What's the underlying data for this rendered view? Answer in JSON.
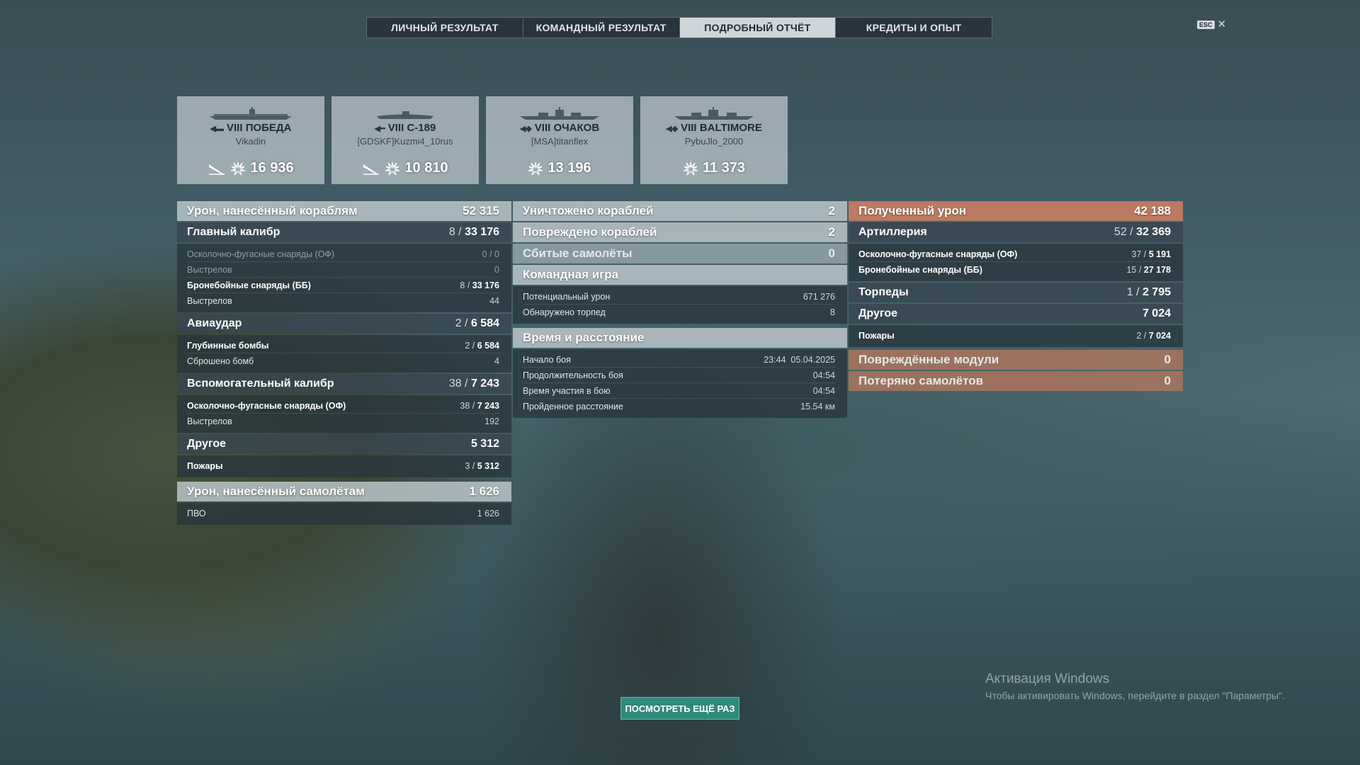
{
  "tabs": [
    "ЛИЧНЫЙ РЕЗУЛЬТАТ",
    "КОМАНДНЫЙ РЕЗУЛЬТАТ",
    "ПОДРОБНЫЙ ОТЧЁТ",
    "КРЕДИТЫ И ОПЫТ"
  ],
  "active_tab": "ПОДРОБНЫЙ ОТЧЁТ",
  "esc": {
    "key": "ESC",
    "close": "✕"
  },
  "ships": [
    {
      "tier": "VIII",
      "name": "ПОБЕДА",
      "player": "Vikadin",
      "damage": "16 936",
      "icon": "aircraft-carrier-icon"
    },
    {
      "tier": "VIII",
      "name": "С-189",
      "player": "[GDSKF]Kuzmi4_10rus",
      "damage": "10 810",
      "icon": "submarine-icon"
    },
    {
      "tier": "VIII",
      "name": "ОЧАКОВ",
      "player": "[MSA]titanflex",
      "damage": "13 196",
      "icon": "cruiser-icon"
    },
    {
      "tier": "VIII",
      "name": "BALTIMORE",
      "player": "PybuJlo_2000",
      "damage": "11 373",
      "icon": "cruiser-icon"
    }
  ],
  "col1": {
    "header": {
      "label": "Урон, нанесённый кораблям",
      "value": "52 315"
    },
    "main_battery": {
      "label": "Главный калибр",
      "hits": "8",
      "value": "33 176"
    },
    "he": {
      "label": "Осколочно-фугасные снаряды (ОФ)",
      "value": "0 / 0"
    },
    "he_shots": {
      "label": "Выстрелов",
      "value": "0"
    },
    "ap": {
      "label": "Бронебойные снаряды (ББ)",
      "hits": "8",
      "value": "33 176"
    },
    "ap_shots": {
      "label": "Выстрелов",
      "value": "44"
    },
    "airstrike": {
      "label": "Авиаудар",
      "hits": "2",
      "value": "6 584"
    },
    "depth": {
      "label": "Глубинные бомбы",
      "hits": "2",
      "value": "6 584"
    },
    "bombs": {
      "label": "Сброшено бомб",
      "value": "4"
    },
    "secondary": {
      "label": "Вспомогательный калибр",
      "hits": "38",
      "value": "7 243"
    },
    "sec_he": {
      "label": "Осколочно-фугасные снаряды (ОФ)",
      "hits": "38",
      "value": "7 243"
    },
    "sec_shots": {
      "label": "Выстрелов",
      "value": "192"
    },
    "other": {
      "label": "Другое",
      "value": "5 312"
    },
    "fires": {
      "label": "Пожары",
      "hits": "3",
      "value": "5 312"
    },
    "planes_header": {
      "label": "Урон, нанесённый самолётам",
      "value": "1 626"
    },
    "aa": {
      "label": "ПВО",
      "value": "1 626"
    }
  },
  "col2": {
    "destroyed": {
      "label": "Уничтожено кораблей",
      "value": "2"
    },
    "damaged": {
      "label": "Повреждено кораблей",
      "value": "2"
    },
    "planes": {
      "label": "Сбитые самолёты",
      "value": "0"
    },
    "team": {
      "label": "Командная игра"
    },
    "potential": {
      "label": "Потенциальный урон",
      "value": "671 276"
    },
    "torps_spotted": {
      "label": "Обнаружено торпед",
      "value": "8"
    },
    "time": {
      "label": "Время и расстояние"
    },
    "start": {
      "label": "Начало боя",
      "value": "23:44  05.04.2025"
    },
    "duration": {
      "label": "Продолжительность боя",
      "value": "04:54"
    },
    "participation": {
      "label": "Время участия в бою",
      "value": "04:54"
    },
    "distance": {
      "label": "Пройденное расстояние",
      "value": "15.54 км"
    }
  },
  "col3": {
    "received": {
      "label": "Полученный урон",
      "value": "42 188"
    },
    "artillery": {
      "label": "Артиллерия",
      "hits": "52",
      "value": "32 369"
    },
    "he": {
      "label": "Осколочно-фугасные снаряды (ОФ)",
      "hits": "37",
      "value": "5 191"
    },
    "ap": {
      "label": "Бронебойные снаряды (ББ)",
      "hits": "15",
      "value": "27 178"
    },
    "torpedoes": {
      "label": "Торпеды",
      "hits": "1",
      "value": "2 795"
    },
    "other": {
      "label": "Другое",
      "value": "7 024"
    },
    "fires": {
      "label": "Пожары",
      "hits": "2",
      "value": "7 024"
    },
    "modules": {
      "label": "Повреждённые модули",
      "value": "0"
    },
    "lost_planes": {
      "label": "Потеряно самолётов",
      "value": "0"
    }
  },
  "replay_label": "ПОСМОТРЕТЬ ЕЩЁ РАЗ",
  "watermark": {
    "title": "Активация Windows",
    "text": "Чтобы активировать Windows, перейдите в раздел \"Параметры\"."
  },
  "colors": {
    "accent_orange": "#d08060",
    "replay_button": "#2f8a7c",
    "active_tab": "#cfd6da"
  }
}
